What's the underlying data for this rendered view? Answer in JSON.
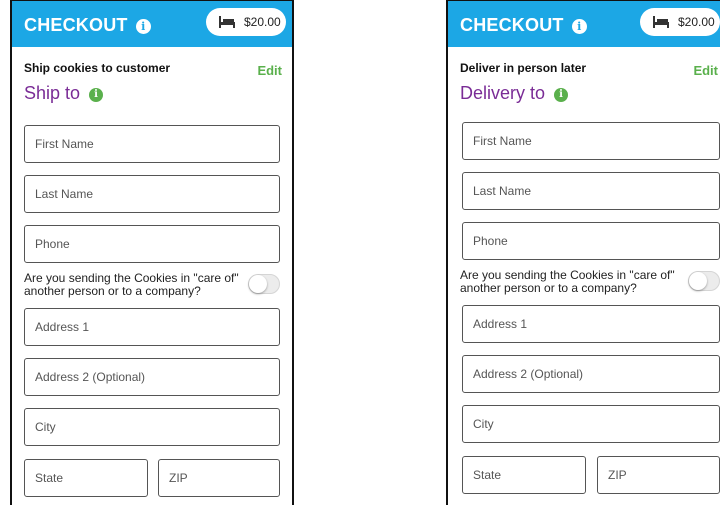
{
  "screens": [
    {
      "header": {
        "title": "CHECKOUT",
        "info_glyph": "i",
        "cart_total": "$20.00",
        "cart_icon": "bed-icon"
      },
      "method_label": "Ship cookies to customer",
      "edit_label": "Edit",
      "section_title": "Ship to",
      "section_info_glyph": "i",
      "form": {
        "first_name_placeholder": "First Name",
        "last_name_placeholder": "Last Name",
        "phone_placeholder": "Phone",
        "care_of_question": "Are you sending the Cookies in \"care of\" another person or to a company?",
        "care_of_enabled": false,
        "address1_placeholder": "Address 1",
        "address2_placeholder": "Address 2 (Optional)",
        "city_placeholder": "City",
        "state_placeholder": "State",
        "zip_placeholder": "ZIP"
      }
    },
    {
      "header": {
        "title": "CHECKOUT",
        "info_glyph": "i",
        "cart_total": "$20.00",
        "cart_icon": "bed-icon"
      },
      "method_label": "Deliver in person later",
      "edit_label": "Edit",
      "section_title": "Delivery to",
      "section_info_glyph": "i",
      "form": {
        "first_name_placeholder": "First Name",
        "last_name_placeholder": "Last Name",
        "phone_placeholder": "Phone",
        "care_of_question": "Are you sending the Cookies in \"care of\" another person or to a company?",
        "care_of_enabled": false,
        "address1_placeholder": "Address 1",
        "address2_placeholder": "Address 2 (Optional)",
        "city_placeholder": "City",
        "state_placeholder": "State",
        "zip_placeholder": "ZIP"
      }
    }
  ],
  "colors": {
    "header_bg": "#1ca7e5",
    "section_title": "#7a2c96",
    "edit_link": "#5ab04c",
    "info_green": "#5ab04c"
  }
}
